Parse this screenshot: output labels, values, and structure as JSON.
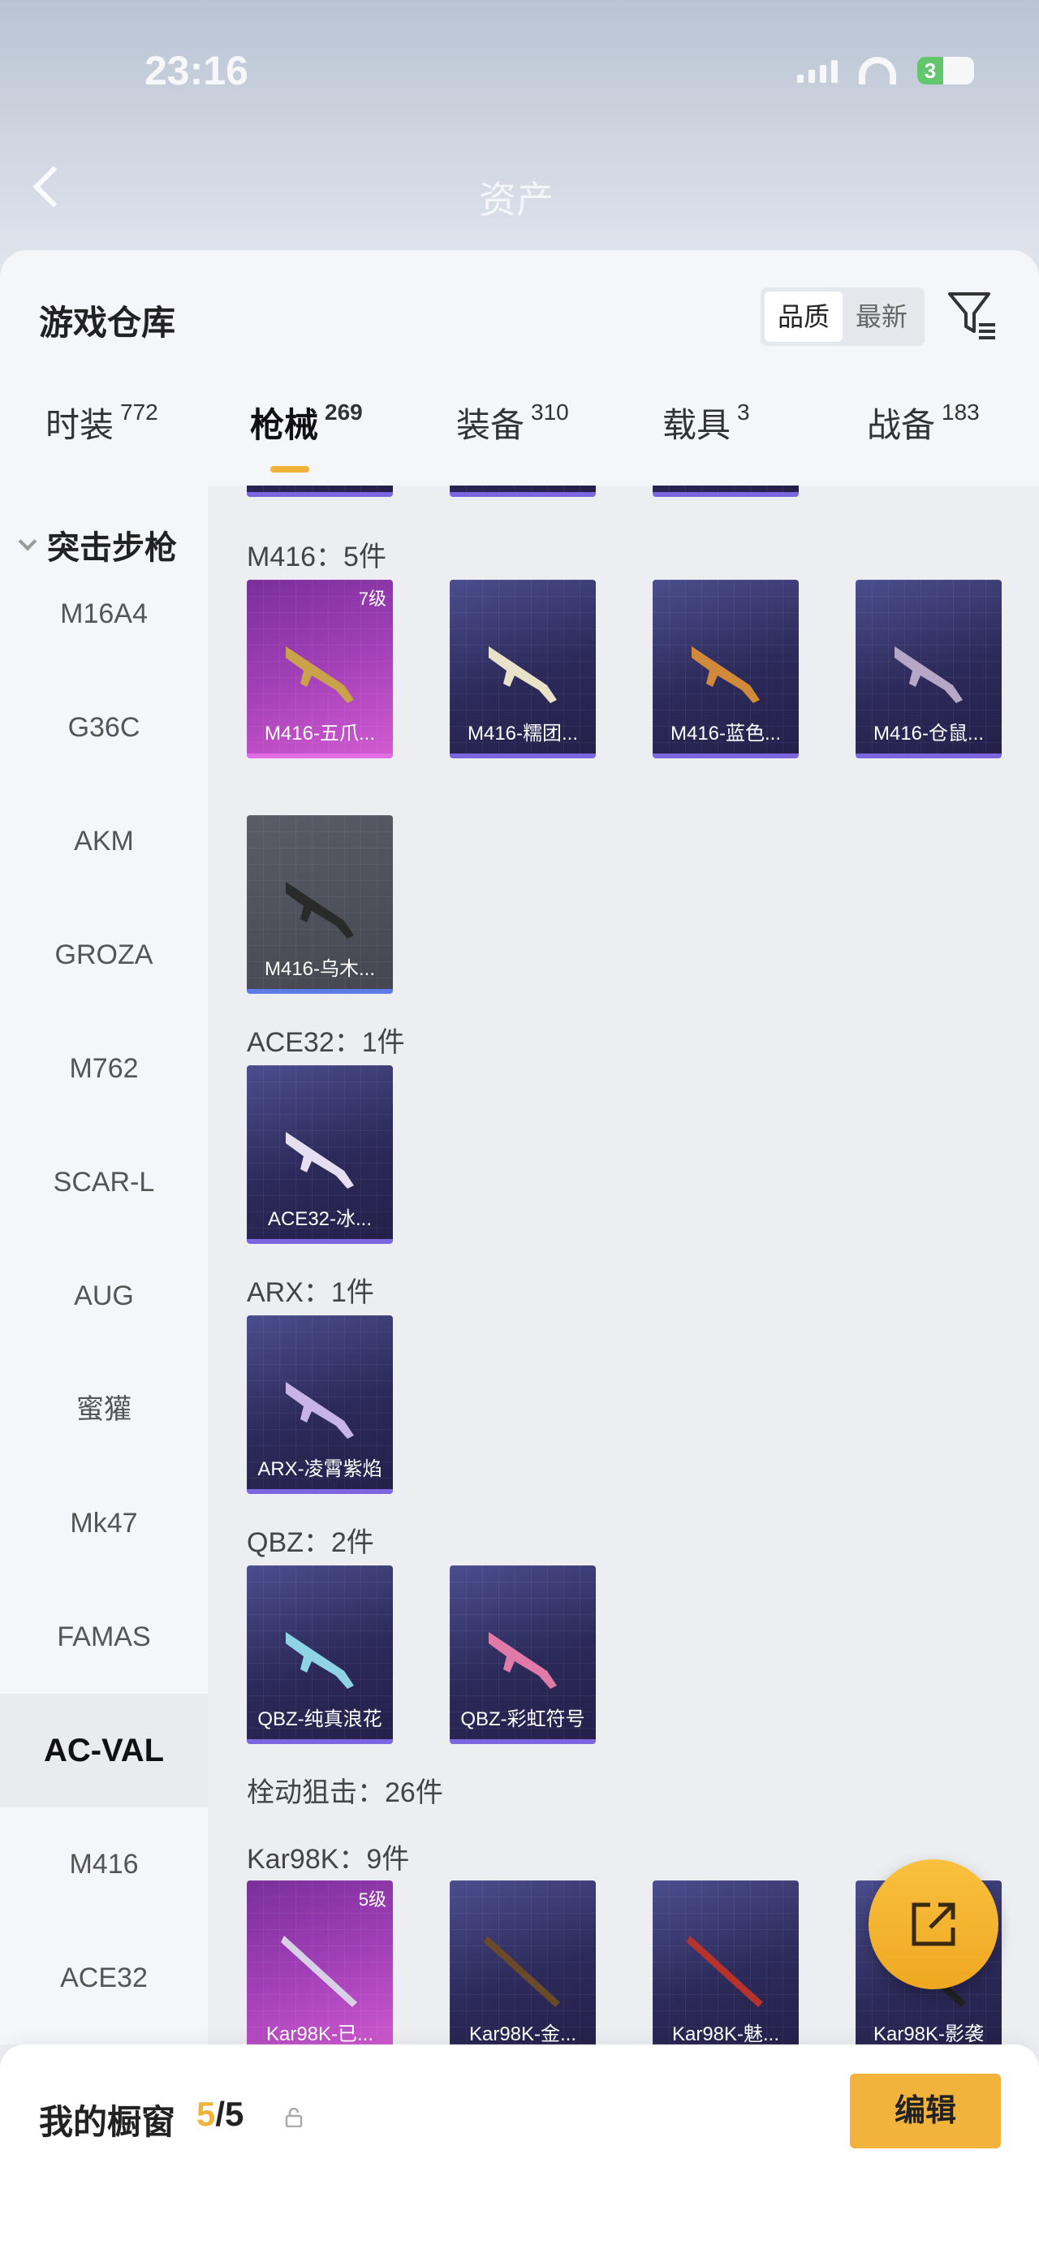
{
  "status_bar": {
    "time": "23:16",
    "battery": "3"
  },
  "header": {
    "title": "资产"
  },
  "warehouse": {
    "title": "游戏仓库",
    "sort": {
      "quality": "品质",
      "newest": "最新"
    }
  },
  "tabs": [
    {
      "label": "时装",
      "count": "772"
    },
    {
      "label": "枪械",
      "count": "269"
    },
    {
      "label": "装备",
      "count": "310"
    },
    {
      "label": "载具",
      "count": "3"
    },
    {
      "label": "战备",
      "count": "183"
    }
  ],
  "sidebar": {
    "category": "突击步枪",
    "items": [
      "M16A4",
      "G36C",
      "AKM",
      "GROZA",
      "M762",
      "SCAR-L",
      "AUG",
      "蜜獾",
      "Mk47",
      "FAMAS",
      "AC-VAL",
      "M416",
      "ACE32"
    ],
    "active": "AC-VAL"
  },
  "groups": {
    "m416": {
      "label": "M416：5件",
      "items": [
        {
          "name": "M416-五爪...",
          "level": "7级",
          "rarity": "purple"
        },
        {
          "name": "M416-糯团...",
          "rarity": "blue"
        },
        {
          "name": "M416-蓝色...",
          "rarity": "blue"
        },
        {
          "name": "M416-仓鼠...",
          "rarity": "blue"
        },
        {
          "name": "M416-乌木...",
          "rarity": "grey"
        }
      ]
    },
    "ace32": {
      "label": "ACE32：1件",
      "items": [
        {
          "name": "ACE32-冰...",
          "rarity": "blue"
        }
      ]
    },
    "arx": {
      "label": "ARX：1件",
      "items": [
        {
          "name": "ARX-凌霄紫焰",
          "rarity": "blue"
        }
      ]
    },
    "qbz": {
      "label": "QBZ：2件",
      "items": [
        {
          "name": "QBZ-纯真浪花",
          "rarity": "blue"
        },
        {
          "name": "QBZ-彩虹符号",
          "rarity": "blue"
        }
      ]
    },
    "bolt": {
      "label": "栓动狙击：26件"
    },
    "kar98k": {
      "label": "Kar98K：9件",
      "items": [
        {
          "name": "Kar98K-已...",
          "level": "5级",
          "rarity": "purple"
        },
        {
          "name": "Kar98K-金...",
          "rarity": "blue"
        },
        {
          "name": "Kar98K-魅...",
          "rarity": "blue"
        },
        {
          "name": "Kar98K-影袭",
          "rarity": "blue"
        }
      ]
    }
  },
  "showcase": {
    "title": "我的橱窗",
    "current": "5",
    "total": "/5",
    "edit": "编辑"
  },
  "colors": {
    "accent": "#f0b33a",
    "card_blue": "#2c2a5a",
    "card_purple": "#a23fb8"
  }
}
